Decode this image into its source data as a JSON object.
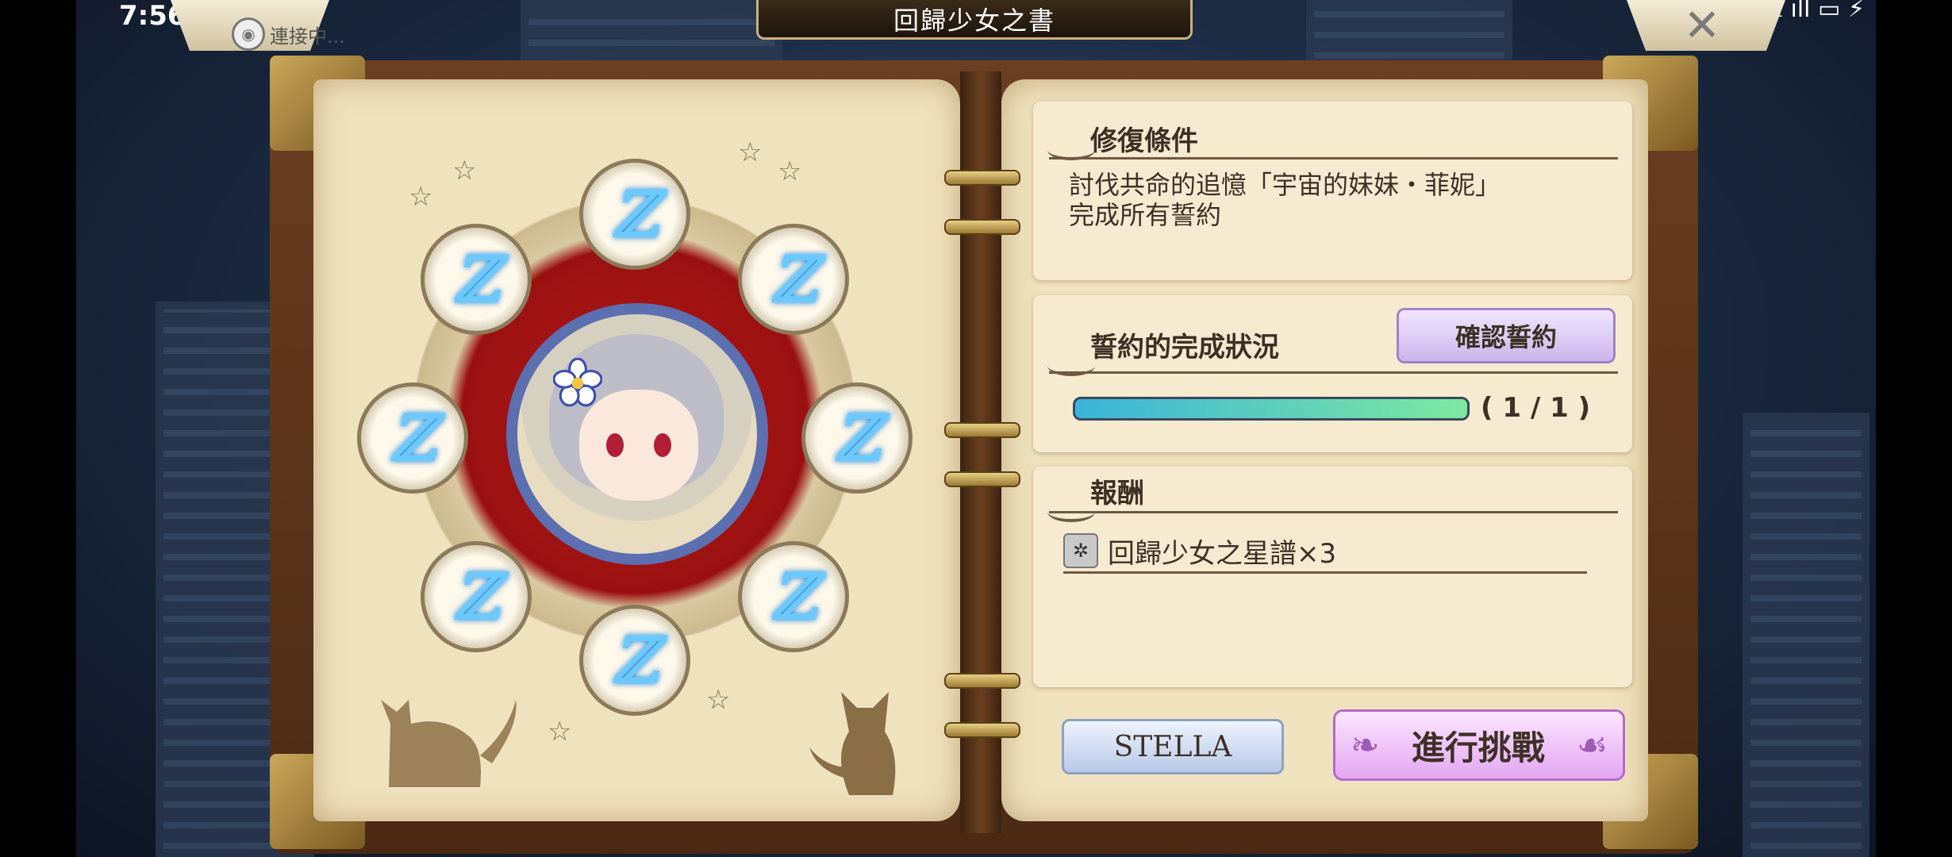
{
  "status": {
    "time": "7:56",
    "right": "✉ ⟟ ıll ▭ ⚡"
  },
  "header": {
    "title": "回歸少女之書",
    "connecting_label": "連接中..."
  },
  "left_page": {
    "runes": [
      "ℤ",
      "ℤ",
      "ℤ",
      "ℤ",
      "ℤ",
      "ℤ",
      "ℤ",
      "ℤ"
    ]
  },
  "conditions": {
    "heading": "修復條件",
    "line1": "討伐共命的追憶「宇宙的妹妹・菲妮」",
    "line2": "完成所有誓約"
  },
  "oath": {
    "heading": "誓約的完成狀況",
    "confirm_label": "確認誓約",
    "progress": 1.0,
    "progress_text": "( 1 / 1 )"
  },
  "reward": {
    "heading": "報酬",
    "icon": "score-sheet-icon",
    "item": "回歸少女之星譜×3"
  },
  "actions": {
    "stella_label": "STELLA",
    "challenge_label": "進行挑戰"
  }
}
